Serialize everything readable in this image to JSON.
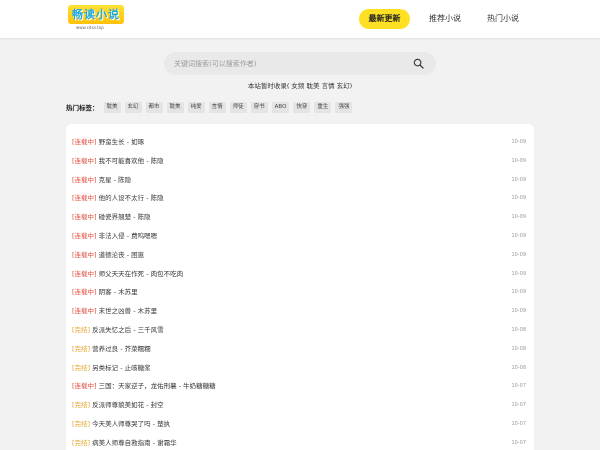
{
  "header": {
    "logo_text": "畅读小说",
    "logo_sub": "www.cdxs.top",
    "nav": [
      "最新更新",
      "推荐小说",
      "热门小说"
    ]
  },
  "search": {
    "placeholder": "关键词搜索(可以搜索作者)",
    "icon": "search-icon"
  },
  "notice": "本站暂时收录( 女频 耽美 言情 玄幻)",
  "tags": {
    "label": "热门标签：",
    "items": [
      "耽美",
      "玄幻",
      "都市",
      "耽美",
      "纯爱",
      "言情",
      "师徒",
      "穿书",
      "ABO",
      "快穿",
      "重生",
      "强强"
    ]
  },
  "books": [
    {
      "status": "[连载中]",
      "title": "野蛮生长 - 如琢",
      "date": "10-09",
      "done": false
    },
    {
      "status": "[连载中]",
      "title": "我不可能喜欢他 - 陈隐",
      "date": "10-09",
      "done": false
    },
    {
      "status": "[连载中]",
      "title": "克星 - 陈隐",
      "date": "10-09",
      "done": false
    },
    {
      "status": "[连载中]",
      "title": "他的人设不太行 - 陈隐",
      "date": "10-09",
      "done": false
    },
    {
      "status": "[连载中]",
      "title": "碰瓷界翘楚 - 陈隐",
      "date": "10-09",
      "done": false
    },
    {
      "status": "[连载中]",
      "title": "非法入侵 - 费呜嗯嗯",
      "date": "10-09",
      "done": false
    },
    {
      "status": "[连载中]",
      "title": "道德沦丧 - 困崽",
      "date": "10-09",
      "done": false
    },
    {
      "status": "[连载中]",
      "title": "师父天天在作死 - 肉包不吃肉",
      "date": "10-09",
      "done": false
    },
    {
      "status": "[连载中]",
      "title": "阴客 - 木苏里",
      "date": "10-09",
      "done": false
    },
    {
      "status": "[连载中]",
      "title": "末世之凶兽 - 木苏里",
      "date": "10-09",
      "done": false
    },
    {
      "status": "[完结]",
      "title": "反派失忆之后 - 三千风雪",
      "date": "10-08",
      "done": true
    },
    {
      "status": "[完结]",
      "title": "营养过良 - 芥菜糯糯",
      "date": "10-08",
      "done": true
    },
    {
      "status": "[完结]",
      "title": "另类标记 - 止咳糖浆",
      "date": "10-08",
      "done": true
    },
    {
      "status": "[连载中]",
      "title": "三国：天家逆子，龙佑刑襄 - 牛奶糖糖糖",
      "date": "10-07",
      "done": false
    },
    {
      "status": "[完结]",
      "title": "反派师尊貌美如花 - 封空",
      "date": "10-07",
      "done": true
    },
    {
      "status": "[完结]",
      "title": "今天美人师尊哭了吗 - 楚执",
      "date": "10-07",
      "done": true
    },
    {
      "status": "[完结]",
      "title": "病美人师尊自救指南 - 谢霜华",
      "date": "10-07",
      "done": true
    }
  ]
}
